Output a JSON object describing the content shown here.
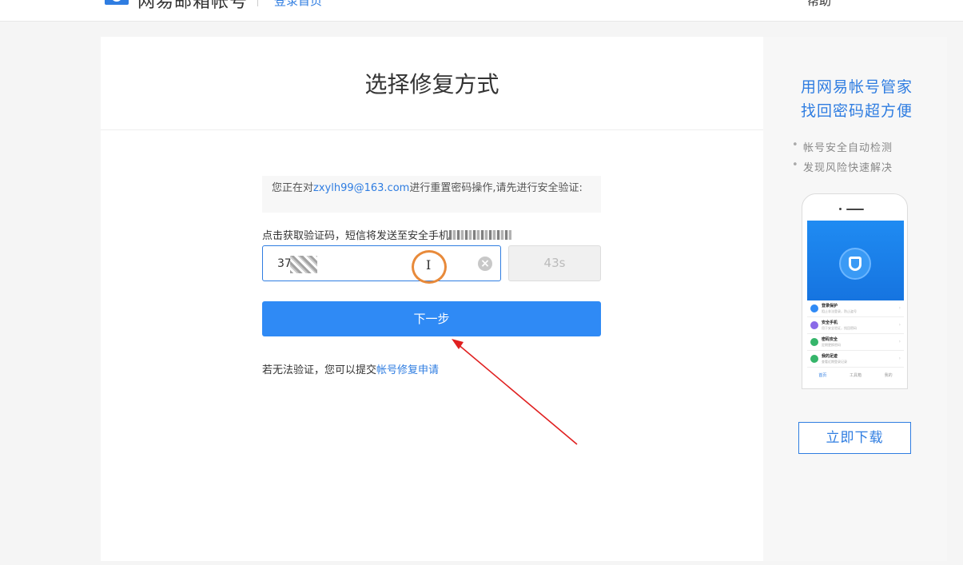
{
  "header": {
    "brand": "网易邮箱帐号",
    "back_link": "登录首页",
    "right_link": "帮助"
  },
  "main": {
    "title": "选择修复方式",
    "notice": {
      "prefix": "您正在对",
      "email": "zxylh99@163.com",
      "suffix": "进行重置密码操作,请先进行安全验证:"
    },
    "sms_hint": "点击获取验证码，短信将发送至安全手机",
    "code_input": {
      "value": "37",
      "placeholder": ""
    },
    "countdown": "43s",
    "next_button": "下一步",
    "appeal": {
      "prefix": "若无法验证，您可以提交",
      "link": "帐号修复申请"
    },
    "text_cursor_glyph": "I",
    "clear_glyph": "×"
  },
  "sidebar": {
    "promo_line1": "用网易帐号管家",
    "promo_line2": "找回密码超方便",
    "features": [
      "帐号安全自动检测",
      "发现风险快速解决"
    ],
    "download_button": "立即下载"
  },
  "phone": {
    "rows": [
      {
        "title": "登录保护",
        "sub": "阻止非法登录，防止盗号",
        "color": "#2f8af5"
      },
      {
        "title": "安全手机",
        "sub": "用于安全验证，找回密码",
        "color": "#8a6ae8"
      },
      {
        "title": "密码安全",
        "sub": "定期更换密码",
        "color": "#35b56a"
      },
      {
        "title": "我的足迹",
        "sub": "查看近期登录记录",
        "color": "#35b56a"
      }
    ],
    "tabs": [
      "首页",
      "工具箱",
      "我的"
    ]
  },
  "colors": {
    "accent": "#2f7de1",
    "button": "#2f8af5",
    "annotation_arrow": "#e02020",
    "annotation_circle": "#e88a3a"
  },
  "icons": [
    "netease-logo-icon",
    "clear-icon",
    "text-cursor-icon",
    "shield-icon",
    "annotation-arrow-icon"
  ]
}
